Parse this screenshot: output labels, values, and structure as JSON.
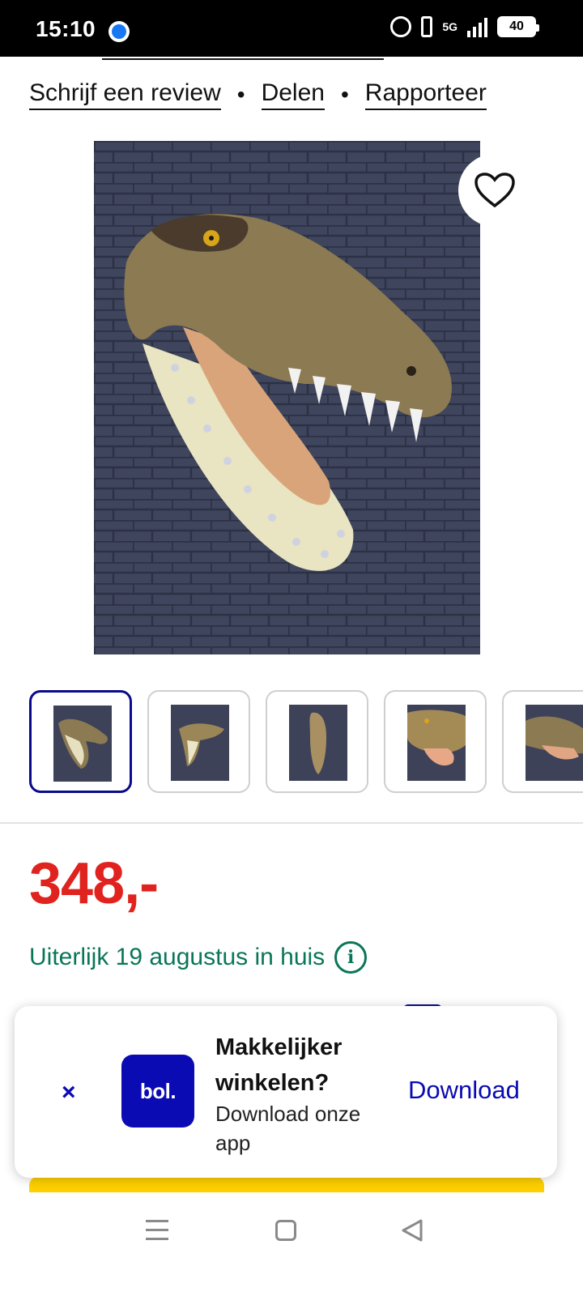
{
  "status_bar": {
    "time": "15:10",
    "network": "5G",
    "battery": "40",
    "icons": [
      "messenger-icon",
      "alarm-icon",
      "vibrate-icon",
      "signal-icon",
      "battery-icon"
    ]
  },
  "top_links": {
    "review": "Schrijf een review",
    "share": "Delen",
    "report": "Rapporteer",
    "separator": "•"
  },
  "product": {
    "images_count": 5,
    "active_thumbnail": 0,
    "price": "348,-",
    "delivery_text": "Uiterlijk 19 augustus in huis",
    "info_icon_glyph": "i"
  },
  "app_banner": {
    "close_glyph": "×",
    "logo_text": "bol.",
    "title": "Makkelijker winkelen?",
    "subtitle": "Download onze app",
    "download_label": "Download"
  },
  "colors": {
    "price": "#e0231e",
    "delivery": "#0a7658",
    "brand_blue": "#0b0bb4",
    "accent_yellow": "#ffd100"
  }
}
